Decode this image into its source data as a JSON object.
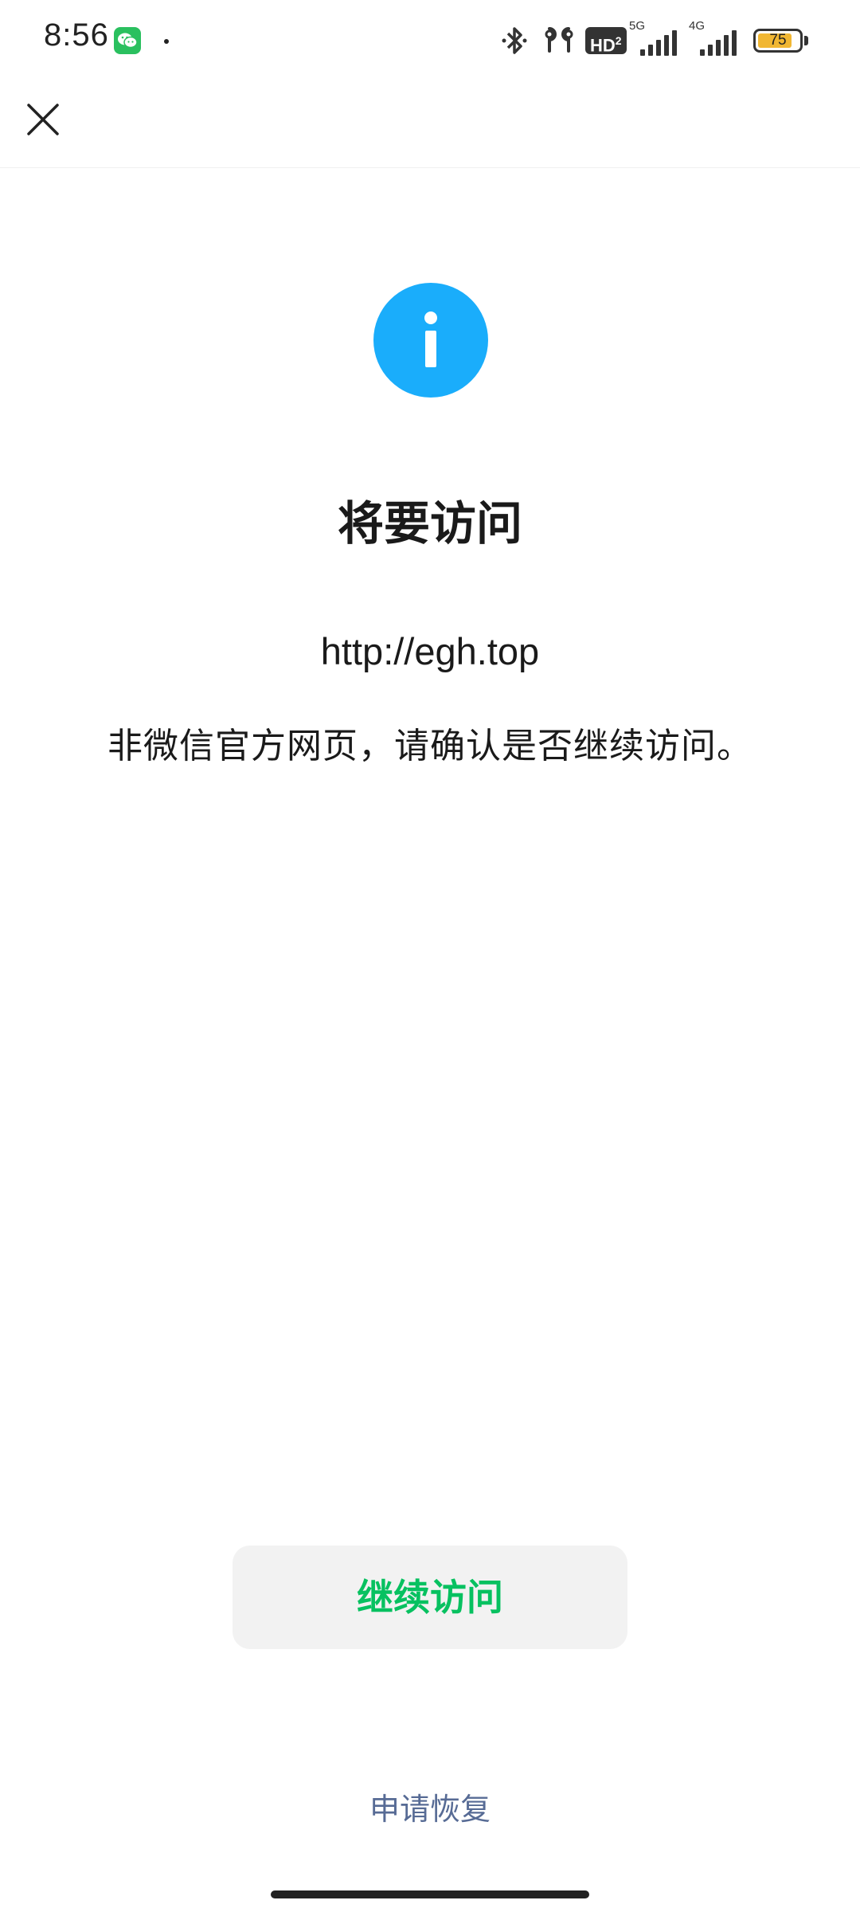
{
  "status_bar": {
    "time": "8:56",
    "notification_app_icon": "wechat-icon",
    "hd_label": "HD",
    "hd_sub": "2",
    "net_primary": "5G",
    "net_secondary": "4G",
    "battery_level": "75",
    "battery_color": "#f1b733"
  },
  "nav": {
    "close_icon": "close-icon"
  },
  "main": {
    "info_icon": "info-icon",
    "info_icon_color": "#1aadfb",
    "title": "将要访问",
    "url": "http://egh.top",
    "warning": "非微信官方网页，请确认是否继续访问。"
  },
  "actions": {
    "continue_label": "继续访问",
    "continue_color": "#07c160",
    "restore_label": "申请恢复",
    "restore_color": "#576b95"
  }
}
